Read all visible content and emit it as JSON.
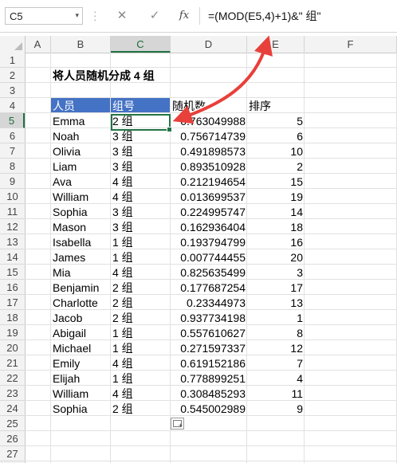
{
  "formula_bar": {
    "name_box": "C5",
    "name_box_dropdown": "▾",
    "cancel_symbol": "✕",
    "enter_symbol": "✓",
    "fx_label": "fx",
    "formula": "=(MOD(E5,4)+1)&\" 组\""
  },
  "columns": [
    "A",
    "B",
    "C",
    "D",
    "E",
    "F"
  ],
  "selected_column": "C",
  "rows": [
    "1",
    "2",
    "3",
    "4",
    "5",
    "6",
    "7",
    "8",
    "9",
    "10",
    "11",
    "12",
    "13",
    "14",
    "15",
    "16",
    "17",
    "18",
    "19",
    "20",
    "21",
    "22",
    "23",
    "24",
    "25",
    "26",
    "27"
  ],
  "selected_row": "5",
  "sheet": {
    "title": "将人员随机分成 4 组",
    "headers": {
      "person": "人员",
      "group": "组号",
      "random": "随机数",
      "rank": "排序"
    },
    "records": [
      {
        "name": "Emma",
        "group": "2 组",
        "random": "0.763049988",
        "rank": "5"
      },
      {
        "name": "Noah",
        "group": "3 组",
        "random": "0.756714739",
        "rank": "6"
      },
      {
        "name": "Olivia",
        "group": "3 组",
        "random": "0.491898573",
        "rank": "10"
      },
      {
        "name": "Liam",
        "group": "3 组",
        "random": "0.893510928",
        "rank": "2"
      },
      {
        "name": "Ava",
        "group": "4 组",
        "random": "0.212194654",
        "rank": "15"
      },
      {
        "name": "William",
        "group": "4 组",
        "random": "0.013699537",
        "rank": "19"
      },
      {
        "name": "Sophia",
        "group": "3 组",
        "random": "0.224995747",
        "rank": "14"
      },
      {
        "name": "Mason",
        "group": "3 组",
        "random": "0.162936404",
        "rank": "18"
      },
      {
        "name": "Isabella",
        "group": "1 组",
        "random": "0.193794799",
        "rank": "16"
      },
      {
        "name": "James",
        "group": "1 组",
        "random": "0.007744455",
        "rank": "20"
      },
      {
        "name": "Mia",
        "group": "4 组",
        "random": "0.825635499",
        "rank": "3"
      },
      {
        "name": "Benjamin",
        "group": "2 组",
        "random": "0.177687254",
        "rank": "17"
      },
      {
        "name": "Charlotte",
        "group": "2 组",
        "random": "0.23344973",
        "rank": "13"
      },
      {
        "name": "Jacob",
        "group": "2 组",
        "random": "0.937734198",
        "rank": "1"
      },
      {
        "name": "Abigail",
        "group": "1 组",
        "random": "0.557610627",
        "rank": "8"
      },
      {
        "name": "Michael",
        "group": "1 组",
        "random": "0.271597337",
        "rank": "12"
      },
      {
        "name": "Emily",
        "group": "4 组",
        "random": "0.619152186",
        "rank": "7"
      },
      {
        "name": "Elijah",
        "group": "1 组",
        "random": "0.778899251",
        "rank": "4"
      },
      {
        "name": "William",
        "group": "4 组",
        "random": "0.308485293",
        "rank": "11"
      },
      {
        "name": "Sophia",
        "group": "2 组",
        "random": "0.545002989",
        "rank": "9"
      }
    ]
  },
  "colors": {
    "header_fill": "#4472c4",
    "selection_green": "#217346",
    "annotation_arrow": "#e8403a"
  },
  "icons": {
    "quick_analysis": "quick-analysis-icon",
    "annotation": "red-curved-arrow"
  }
}
